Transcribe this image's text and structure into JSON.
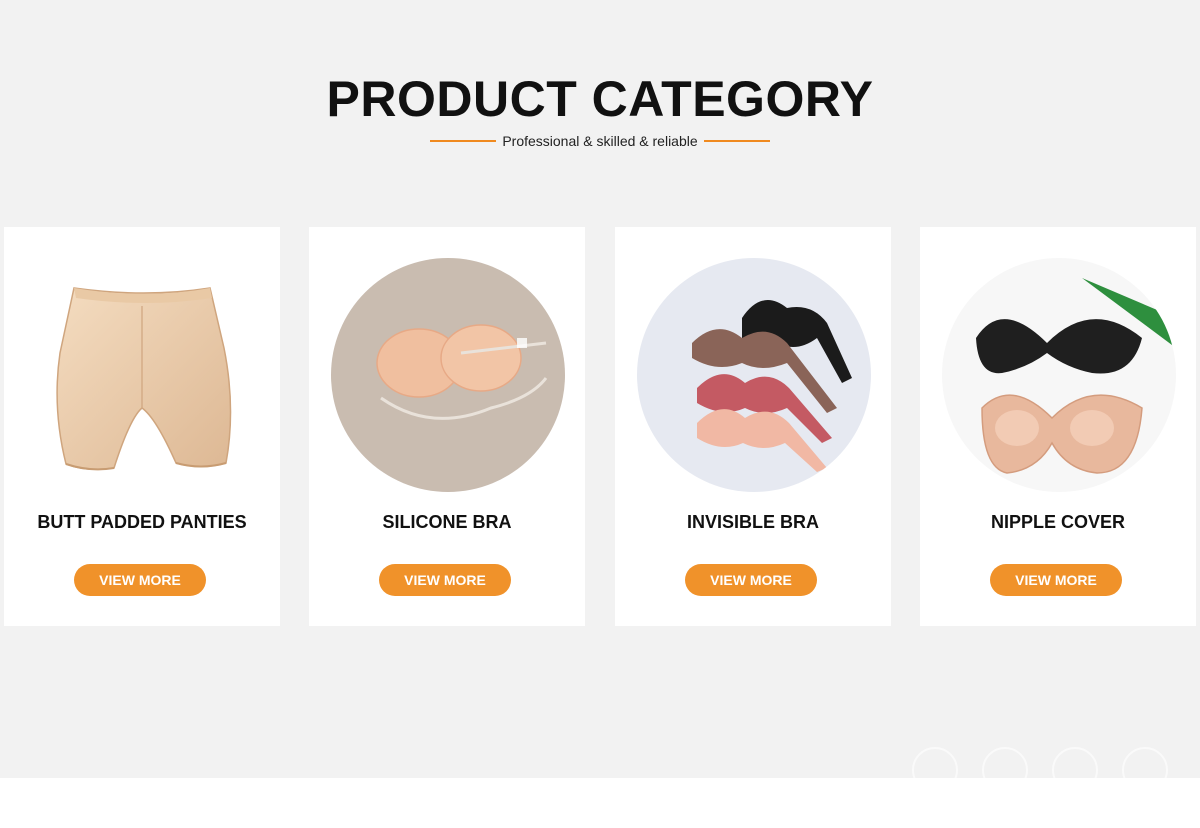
{
  "header": {
    "title": "PRODUCT CATEGORY",
    "subtitle": "Professional & skilled & reliable"
  },
  "colors": {
    "accent": "#f0922a",
    "background": "#f2f2f2",
    "card": "#ffffff"
  },
  "categories": [
    {
      "name": "BUTT PADDED PANTIES",
      "button": "VIEW MORE",
      "image": "padded-panties-photo"
    },
    {
      "name": "SILICONE BRA",
      "button": "VIEW MORE",
      "image": "silicone-bra-photo"
    },
    {
      "name": "INVISIBLE BRA",
      "button": "VIEW MORE",
      "image": "invisible-bra-photo"
    },
    {
      "name": "NIPPLE COVER",
      "button": "VIEW MORE",
      "image": "nipple-cover-photo"
    }
  ]
}
